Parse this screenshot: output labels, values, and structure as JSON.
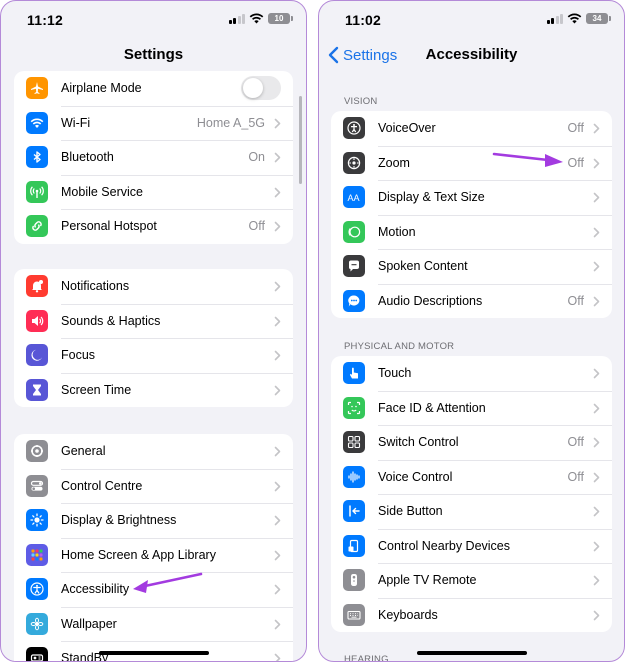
{
  "left": {
    "status_time": "11:12",
    "battery": "10",
    "title": "Settings",
    "groups": [
      [
        {
          "label": "Airplane Mode",
          "value": "",
          "color": "#ff9500",
          "icon": "airplane-icon",
          "toggle": true
        },
        {
          "label": "Wi-Fi",
          "value": "Home A_5G",
          "color": "#007aff",
          "icon": "wifi-icon"
        },
        {
          "label": "Bluetooth",
          "value": "On",
          "color": "#007aff",
          "icon": "bluetooth-icon"
        },
        {
          "label": "Mobile Service",
          "value": "",
          "color": "#34c759",
          "icon": "antenna-icon"
        },
        {
          "label": "Personal Hotspot",
          "value": "Off",
          "color": "#34c759",
          "icon": "hotspot-icon"
        }
      ],
      [
        {
          "label": "Notifications",
          "value": "",
          "color": "#ff3b30",
          "icon": "bell-icon"
        },
        {
          "label": "Sounds & Haptics",
          "value": "",
          "color": "#ff2d55",
          "icon": "speaker-icon"
        },
        {
          "label": "Focus",
          "value": "",
          "color": "#5856d6",
          "icon": "moon-icon"
        },
        {
          "label": "Screen Time",
          "value": "",
          "color": "#5856d6",
          "icon": "hourglass-icon"
        }
      ],
      [
        {
          "label": "General",
          "value": "",
          "color": "#8e8e93",
          "icon": "gear-icon"
        },
        {
          "label": "Control Centre",
          "value": "",
          "color": "#8e8e93",
          "icon": "switches-icon"
        },
        {
          "label": "Display & Brightness",
          "value": "",
          "color": "#007aff",
          "icon": "sun-icon"
        },
        {
          "label": "Home Screen & App Library",
          "value": "",
          "color": "#5e5ce6",
          "icon": "grid-icon"
        },
        {
          "label": "Accessibility",
          "value": "",
          "color": "#007aff",
          "icon": "accessibility-icon"
        },
        {
          "label": "Wallpaper",
          "value": "",
          "color": "#34aadc",
          "icon": "flower-icon"
        },
        {
          "label": "StandBy",
          "value": "",
          "color": "#000000",
          "icon": "standby-icon"
        }
      ]
    ]
  },
  "right": {
    "status_time": "11:02",
    "battery": "34",
    "back_label": "Settings",
    "title": "Accessibility",
    "sections": [
      {
        "header": "VISION",
        "items": [
          {
            "label": "VoiceOver",
            "value": "Off",
            "color": "#3a3a3c",
            "icon": "voiceover-icon"
          },
          {
            "label": "Zoom",
            "value": "Off",
            "color": "#3a3a3c",
            "icon": "zoom-icon"
          },
          {
            "label": "Display & Text Size",
            "value": "",
            "color": "#007aff",
            "icon": "text-size-icon"
          },
          {
            "label": "Motion",
            "value": "",
            "color": "#34c759",
            "icon": "motion-icon"
          },
          {
            "label": "Spoken Content",
            "value": "",
            "color": "#3a3a3c",
            "icon": "speech-bubble-icon"
          },
          {
            "label": "Audio Descriptions",
            "value": "Off",
            "color": "#007aff",
            "icon": "audio-description-icon"
          }
        ]
      },
      {
        "header": "PHYSICAL AND MOTOR",
        "items": [
          {
            "label": "Touch",
            "value": "",
            "color": "#007aff",
            "icon": "hand-icon"
          },
          {
            "label": "Face ID & Attention",
            "value": "",
            "color": "#34c759",
            "icon": "face-id-icon"
          },
          {
            "label": "Switch Control",
            "value": "Off",
            "color": "#3a3a3c",
            "icon": "switch-grid-icon"
          },
          {
            "label": "Voice Control",
            "value": "Off",
            "color": "#007aff",
            "icon": "waveform-icon"
          },
          {
            "label": "Side Button",
            "value": "",
            "color": "#007aff",
            "icon": "side-button-icon"
          },
          {
            "label": "Control Nearby Devices",
            "value": "",
            "color": "#007aff",
            "icon": "nearby-devices-icon"
          },
          {
            "label": "Apple TV Remote",
            "value": "",
            "color": "#8e8e93",
            "icon": "remote-icon"
          },
          {
            "label": "Keyboards",
            "value": "",
            "color": "#8e8e93",
            "icon": "keyboard-icon"
          }
        ]
      },
      {
        "header": "HEARING",
        "items": []
      }
    ]
  },
  "annotation_color": "#a33be0"
}
